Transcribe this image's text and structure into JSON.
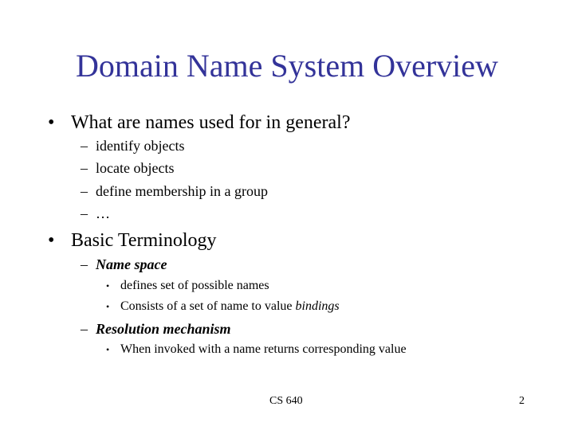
{
  "slide": {
    "title": "Domain Name System Overview",
    "bullets": [
      {
        "text": "What are names used for in general?",
        "subitems": [
          {
            "text": "identify objects"
          },
          {
            "text": "locate objects"
          },
          {
            "text": "define membership in a group"
          },
          {
            "text": "…"
          }
        ]
      },
      {
        "text": "Basic Terminology",
        "subitems": [
          {
            "text": "Name space",
            "points": [
              {
                "text": "defines set of possible names"
              },
              {
                "text": "Consists of a set of name to value ",
                "emphasis": "bindings"
              }
            ]
          },
          {
            "text": "Resolution mechanism",
            "points": [
              {
                "text": "When invoked with a name returns corresponding value"
              }
            ]
          }
        ]
      }
    ],
    "bullet_glyph": "•",
    "dash_glyph": "–",
    "small_bullet_glyph": "•"
  },
  "footer": {
    "course": "CS 640",
    "page_number": "2"
  },
  "colors": {
    "title": "#333399",
    "text": "#000000",
    "background": "#ffffff"
  }
}
